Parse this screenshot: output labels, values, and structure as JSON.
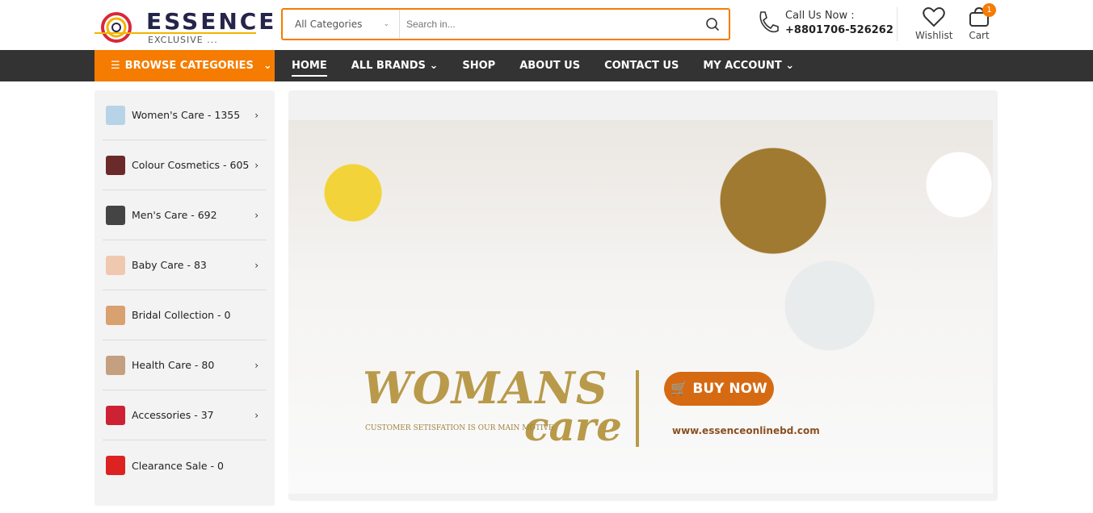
{
  "logo": {
    "name": "ESSENCE",
    "tagline": "EXCLUSIVE ..."
  },
  "search": {
    "category": "All Categories",
    "placeholder": "Search in..."
  },
  "contact": {
    "label": "Call Us Now :",
    "phone": "+8801706-526262"
  },
  "wishlist": {
    "label": "Wishlist"
  },
  "cart": {
    "label": "Cart",
    "count": "1"
  },
  "nav": {
    "browse": "BROWSE CATEGORIES",
    "items": [
      "HOME",
      "ALL BRANDS",
      "SHOP",
      "ABOUT US",
      "CONTACT US",
      "MY ACCOUNT"
    ]
  },
  "categories": [
    {
      "label": "Women's Care - 1355",
      "chevron": true
    },
    {
      "label": "Colour Cosmetics - 605",
      "chevron": true
    },
    {
      "label": "Men's Care - 692",
      "chevron": true
    },
    {
      "label": "Baby Care - 83",
      "chevron": true
    },
    {
      "label": "Bridal Collection - 0",
      "chevron": false
    },
    {
      "label": "Health Care - 80",
      "chevron": true
    },
    {
      "label": "Accessories - 37",
      "chevron": true
    },
    {
      "label": "Clearance Sale - 0",
      "chevron": false
    }
  ],
  "banner": {
    "title1": "WOMANS",
    "title2": "care",
    "motive": "CUSTOMER SETISFATION IS OUR MAIN MOTIVE",
    "cta": "BUY NOW",
    "url": "www.essenceonlinebd.com"
  },
  "colors": {
    "accent": "#f57c00",
    "nav_bg": "#333333"
  }
}
